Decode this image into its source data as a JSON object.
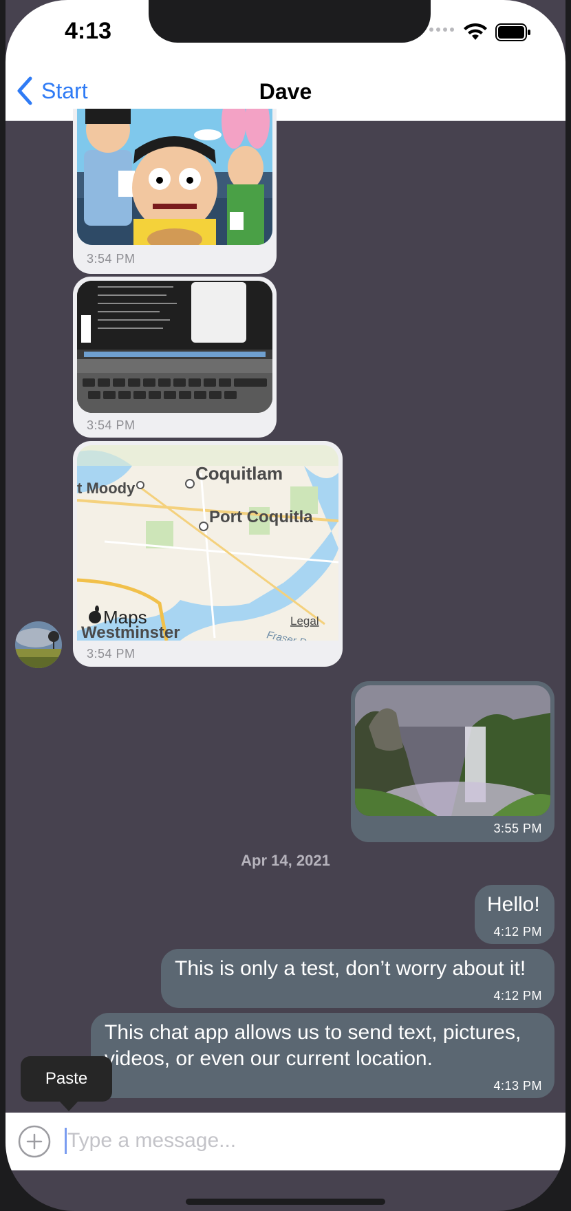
{
  "status_bar": {
    "time": "4:13"
  },
  "nav": {
    "back_label": "Start",
    "title": "Dave"
  },
  "messages": [
    {
      "kind": "image",
      "direction": "incoming",
      "image": "cartoon-characters-photo",
      "time": "3:54 PM"
    },
    {
      "kind": "image",
      "direction": "incoming",
      "image": "laptop-terminal-photo",
      "time": "3:54 PM"
    },
    {
      "kind": "location",
      "direction": "incoming",
      "time": "3:54 PM",
      "map": {
        "places": [
          "Coquitlam",
          "t Moody",
          "Port Coquitla",
          "Westminster"
        ],
        "river": "Fraser R",
        "brand": "Maps",
        "legal": "Legal"
      }
    },
    {
      "kind": "image",
      "direction": "outgoing",
      "image": "waterfall-photo",
      "time": "3:55 PM"
    },
    {
      "kind": "date",
      "text": "Apr 14, 2021"
    },
    {
      "kind": "text",
      "direction": "outgoing",
      "text": "Hello!",
      "time": "4:12 PM"
    },
    {
      "kind": "text",
      "direction": "outgoing",
      "text": "This is only a test, don’t worry about it!",
      "time": "4:12 PM"
    },
    {
      "kind": "text",
      "direction": "outgoing",
      "lines": [
        "This chat app allows us to send text, pictures,",
        "videos, or even our current location."
      ],
      "time": "4:13 PM"
    }
  ],
  "context_menu": {
    "paste_label": "Paste"
  },
  "composer": {
    "placeholder": "Type a message..."
  },
  "colors": {
    "accent": "#2f7bf5",
    "chat_background": "#47424f",
    "incoming_bubble": "#efeff2",
    "outgoing_bubble": "#5b6772"
  }
}
